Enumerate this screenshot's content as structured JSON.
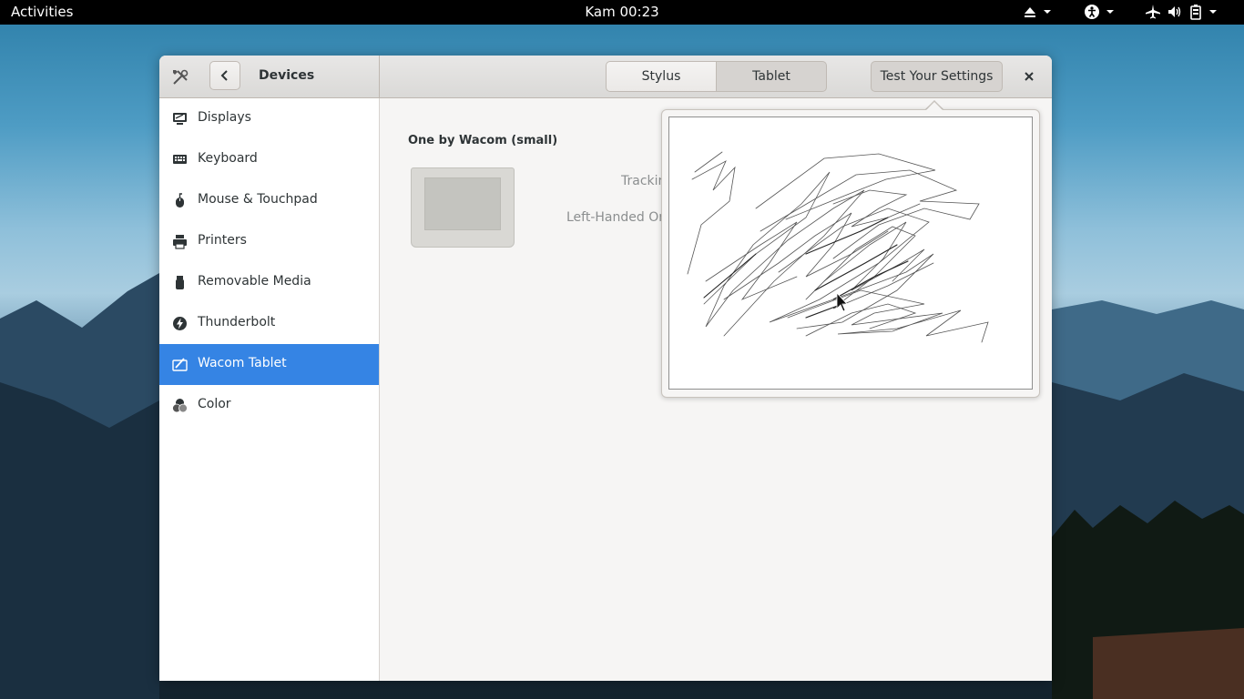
{
  "topbar": {
    "activities_label": "Activities",
    "clock": "Kam 00:23",
    "icons": [
      "eject-icon",
      "chevron-down-icon",
      "accessibility-icon",
      "chevron-down-icon",
      "airplane-icon",
      "volume-icon",
      "battery-icon"
    ]
  },
  "header": {
    "title": "Devices",
    "tabs": [
      {
        "label": "Stylus",
        "selected": false
      },
      {
        "label": "Tablet",
        "selected": true
      }
    ],
    "test_button_label": "Test Your Settings"
  },
  "sidebar": {
    "items": [
      {
        "label": "Displays",
        "icon": "display-icon"
      },
      {
        "label": "Keyboard",
        "icon": "keyboard-icon"
      },
      {
        "label": "Mouse & Touchpad",
        "icon": "mouse-icon"
      },
      {
        "label": "Printers",
        "icon": "printer-icon"
      },
      {
        "label": "Removable Media",
        "icon": "usb-icon"
      },
      {
        "label": "Thunderbolt",
        "icon": "thunderbolt-icon"
      },
      {
        "label": "Wacom Tablet",
        "icon": "wacom-icon",
        "selected": true
      },
      {
        "label": "Color",
        "icon": "color-icon"
      }
    ]
  },
  "main": {
    "device_name": "One by Wacom (small)",
    "settings": [
      {
        "label": "Tracking Mode"
      },
      {
        "label": "Left-Handed Orientation"
      }
    ]
  },
  "colors": {
    "accent": "#3584e4",
    "headerbar": "#dad9d7",
    "window_bg": "#f6f5f4"
  }
}
